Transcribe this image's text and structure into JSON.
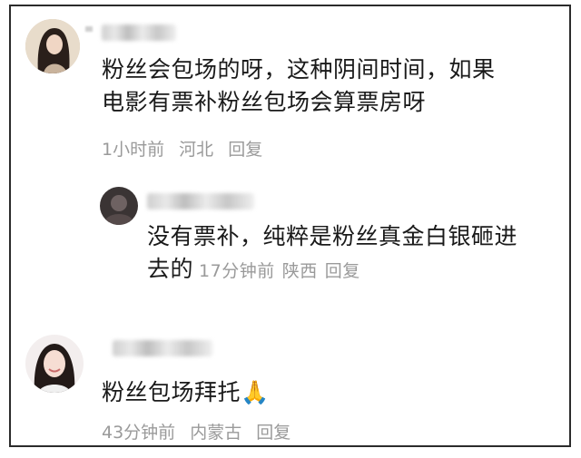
{
  "comments": [
    {
      "author_masked": true,
      "text_line1": "粉丝会包场的呀，这种阴间时间，如果",
      "text_line2": "电影有票补粉丝包场会算票房呀",
      "time": "1小时前",
      "location": "河北",
      "reply_label": "回复",
      "reply": {
        "author_masked": true,
        "text_line1": "没有票补，纯粹是粉丝真金白银砸进",
        "text_line2": "去的",
        "time": "17分钟前",
        "location": "陕西",
        "reply_label": "回复"
      }
    },
    {
      "author_masked": true,
      "text": "粉丝包场拜托🙏",
      "time": "43分钟前",
      "location": "内蒙古",
      "reply_label": "回复"
    }
  ],
  "colors": {
    "text": "#1a1a1a",
    "meta": "#9a9a9a",
    "border": "#2b2b2b"
  },
  "icons": [
    "avatar-woman-dark-hair",
    "avatar-dark-blurred",
    "avatar-woman-smiling",
    "praying-hands-emoji"
  ]
}
